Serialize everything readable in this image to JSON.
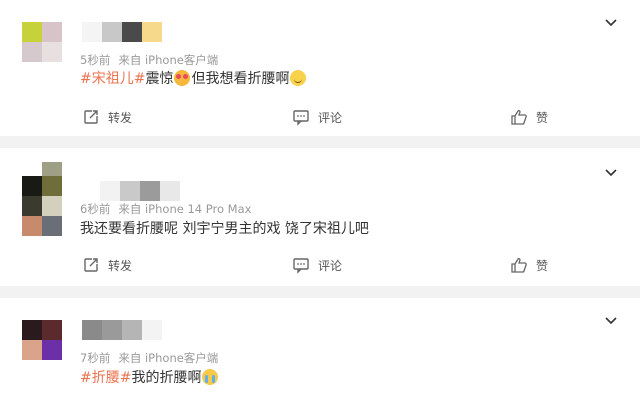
{
  "comments": [
    {
      "time": "5秒前",
      "source": "来自 iPhone客户端",
      "tag": "#宋祖儿#",
      "text_after_tag": "震惊",
      "emoji1": "shocked-emoji",
      "text_after_emoji": "但我想看折腰啊",
      "emoji2": "smile-emoji",
      "actions": {
        "repost": "转发",
        "comment": "评论",
        "like": "赞"
      }
    },
    {
      "time": "6秒前",
      "source": "来自 iPhone 14 Pro Max",
      "text": "我还要看折腰呢 刘宇宁男主的戏 饶了宋祖儿吧",
      "actions": {
        "repost": "转发",
        "comment": "评论",
        "like": "赞"
      }
    },
    {
      "time": "7秒前",
      "source": "来自 iPhone客户端",
      "tag": "#折腰#",
      "text_after_tag": "我的折腰啊",
      "emoji1": "crying-emoji"
    }
  ],
  "colors": {
    "tag": "#eb7350",
    "meta": "#999999",
    "background": "#f2f2f2"
  }
}
